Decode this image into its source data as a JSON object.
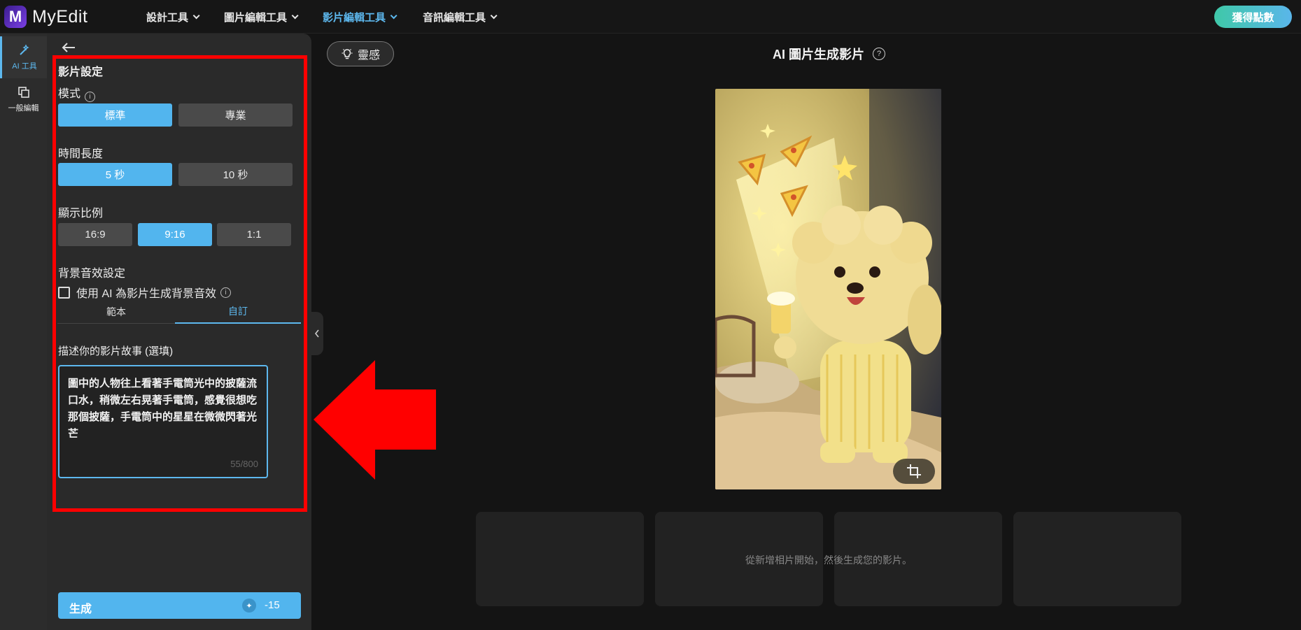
{
  "header": {
    "logo_letter": "M",
    "logo_text": "MyEdit",
    "nav": [
      "設計工具",
      "圖片編輯工具",
      "影片編輯工具",
      "音訊編輯工具"
    ],
    "points_button": "獲得點數"
  },
  "rail": {
    "ai_tools": "AI 工具",
    "general_edit": "一般編輯"
  },
  "panel": {
    "title": "影片設定",
    "mode_label": "模式",
    "mode_options": [
      "標準",
      "專業"
    ],
    "duration_label": "時間長度",
    "duration_options": [
      "5 秒",
      "10 秒"
    ],
    "ratio_label": "顯示比例",
    "ratio_options": [
      "16:9",
      "9:16",
      "1:1"
    ],
    "sound_label": "背景音效設定",
    "sound_checkbox": "使用 AI 為影片生成背景音效",
    "tabs": [
      "範本",
      "自訂"
    ],
    "story_label": "描述你的影片故事 (選填)",
    "story_text": "圖中的人物往上看著手電筒光中的披薩流口水，稍微左右晃著手電筒，感覺很想吃那個披薩，手電筒中的星星在微微閃著光芒",
    "story_count": "55/800",
    "generate_label": "生成",
    "generate_cost": "-15"
  },
  "stage": {
    "inspire_button": "靈感",
    "title": "AI 圖片生成影片",
    "thumbnail_hint": "從新增相片開始，然後生成您的影片。"
  },
  "colors": {
    "accent": "#52b5ee",
    "annotation": "#ff0000"
  }
}
